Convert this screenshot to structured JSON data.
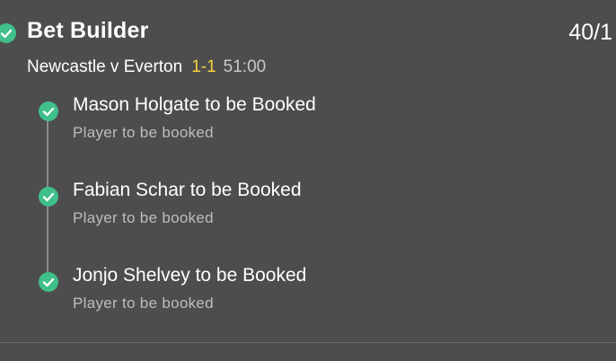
{
  "bet": {
    "title": "Bet Builder",
    "odds": "40/1",
    "match": "Newcastle v Everton",
    "score": "1-1",
    "clock": "51:00"
  },
  "selections": [
    {
      "title": "Mason Holgate to be Booked",
      "subtitle": "Player to be booked"
    },
    {
      "title": "Fabian Schar to be Booked",
      "subtitle": "Player to be booked"
    },
    {
      "title": "Jonjo Shelvey to be Booked",
      "subtitle": "Player to be booked"
    }
  ],
  "colors": {
    "background": "#4d4d4d",
    "check": "#3fbf8a",
    "score": "#f5d33a"
  },
  "icons": {
    "header": "check-circle-icon",
    "selection": "check-circle-icon"
  }
}
